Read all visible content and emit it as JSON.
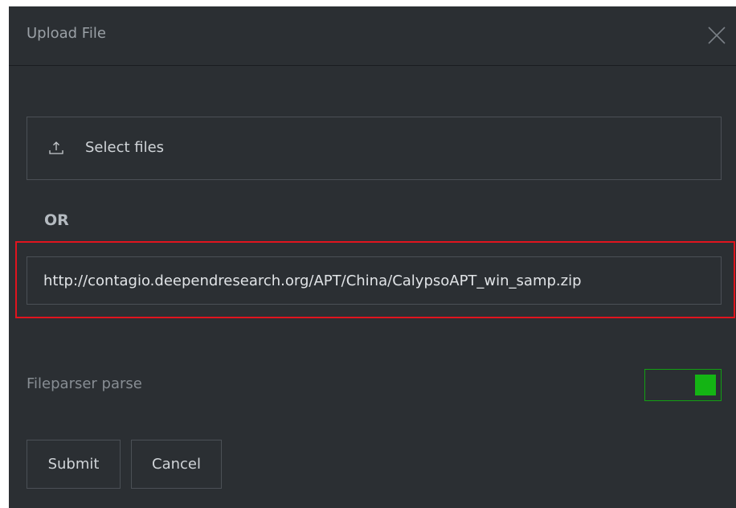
{
  "dialog": {
    "title": "Upload File",
    "close_icon": "close-icon"
  },
  "select_files": {
    "icon": "upload-icon",
    "label": "Select files"
  },
  "or_label": "OR",
  "url_input": {
    "value": "http://contagio.deependresearch.org/APT/China/CalypsoAPT_win_samp.zip",
    "highlight_color": "#e0141e"
  },
  "fileparser": {
    "label": "Fileparser parse",
    "enabled": true,
    "accent_color": "#14b414"
  },
  "buttons": {
    "submit_label": "Submit",
    "cancel_label": "Cancel"
  }
}
